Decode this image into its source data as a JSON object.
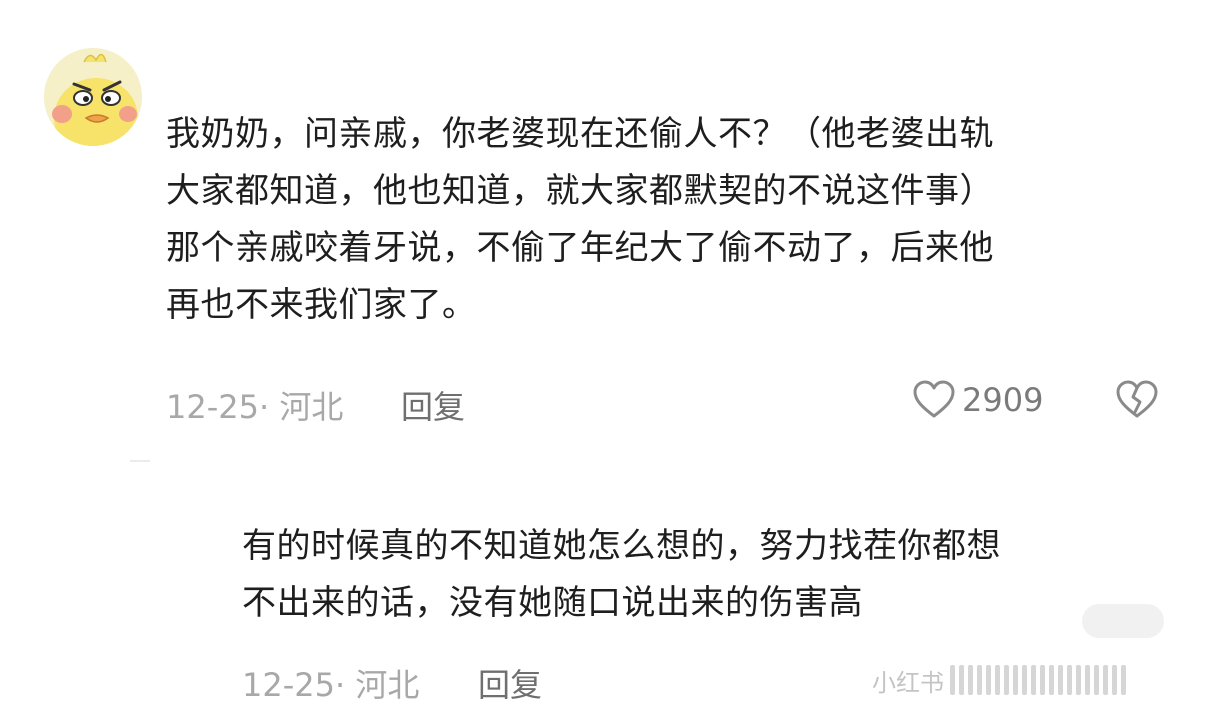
{
  "comment": {
    "text_lines": [
      "我奶奶，问亲戚，你老婆现在还偷人不？（他老婆出轨",
      "大家都知道，他也知道，就大家都默契的不说这件事）",
      "那个亲戚咬着牙说，不偷了年纪大了偷不动了，后来他",
      "再也不来我们家了。"
    ],
    "meta": "12-25· 河北",
    "reply_label": "回复",
    "like_count": "2909",
    "avatar_icon": "yellow-duck-avatar",
    "like_icon": "heart-outline-icon",
    "dislike_icon": "broken-heart-icon"
  },
  "reply": {
    "text_lines": [
      "有的时候真的不知道她怎么想的，努力找茬你都想",
      "不出来的话，没有她随口说出来的伤害高"
    ],
    "meta": "12-25· 河北",
    "reply_label": "回复"
  },
  "watermark": {
    "brand": "小红书"
  }
}
